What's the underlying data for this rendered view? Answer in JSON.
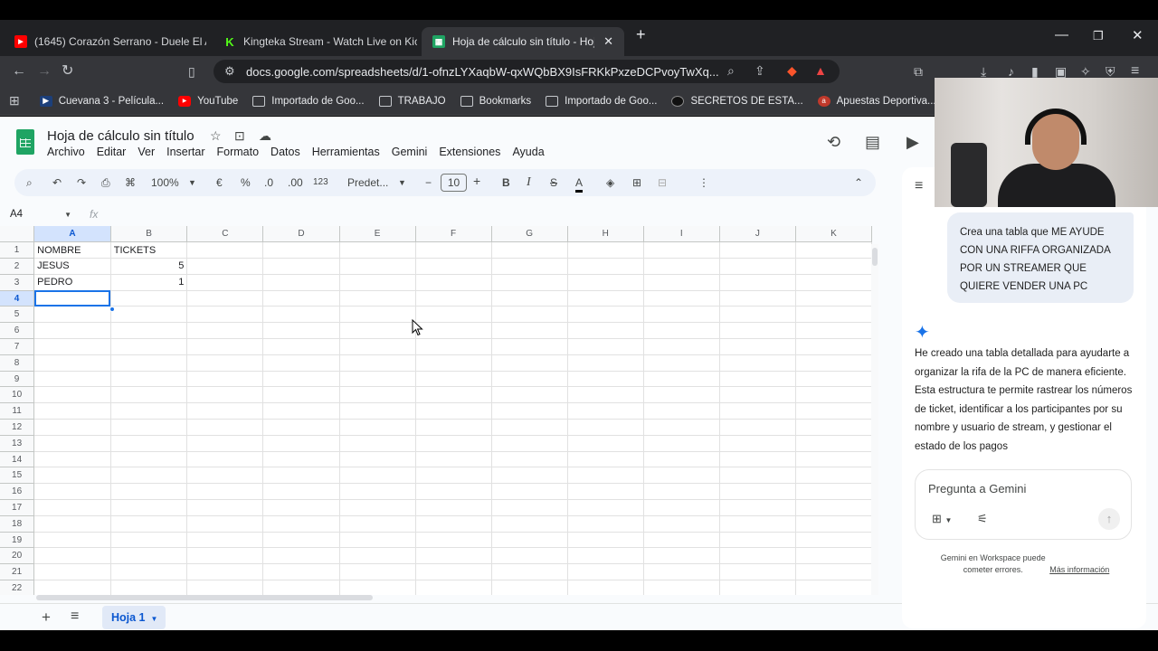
{
  "browser": {
    "tabs": [
      {
        "title": "(1645) Corazón Serrano - Duele El A",
        "icon": "youtube-icon",
        "color": "#ff0000"
      },
      {
        "title": "Kingteka Stream - Watch Live on Kick",
        "icon": "kick-icon",
        "color": "#53fc18"
      },
      {
        "title": "Hoja de cálculo sin título - Hojas",
        "icon": "sheets-icon",
        "color": "#1fa463",
        "active": true
      }
    ],
    "url": "docs.google.com/spreadsheets/d/1-ofnzLYXaqbW-qxWQbBX9IsFRKkPxzeDCPvoyTwXq...",
    "bookmarks": [
      {
        "label": "Cuevana 3 - Película...",
        "icon": "cuevana-icon"
      },
      {
        "label": "YouTube",
        "icon": "youtube-icon"
      },
      {
        "label": "Importado de Goo...",
        "icon": "folder-icon"
      },
      {
        "label": "TRABAJO",
        "icon": "folder-icon"
      },
      {
        "label": "Bookmarks",
        "icon": "bookmarks-icon"
      },
      {
        "label": "Importado de Goo...",
        "icon": "folder-icon"
      },
      {
        "label": "SECRETOS DE ESTA...",
        "icon": "site-icon"
      },
      {
        "label": "Apuestas Deportiva...",
        "icon": "site-icon"
      }
    ]
  },
  "sheets": {
    "title": "Hoja de cálculo sin título",
    "menu": [
      "Archivo",
      "Editar",
      "Ver",
      "Insertar",
      "Formato",
      "Datos",
      "Herramientas",
      "Gemini",
      "Extensiones",
      "Ayuda"
    ],
    "toolbar": {
      "zoom": "100%",
      "currency": "€",
      "percent": "%",
      "dec_decrease": ".0",
      "dec_increase": ".00",
      "number_format": "123",
      "font": "Predet...",
      "font_size": "10",
      "bold": "B",
      "italic": "I",
      "strike": "S",
      "text_color": "A"
    },
    "name_box": "A4",
    "fx": "fx",
    "columns": [
      "A",
      "B",
      "C",
      "D",
      "E",
      "F",
      "G",
      "H",
      "I",
      "J",
      "K"
    ],
    "rows": [
      "1",
      "2",
      "3",
      "4",
      "5",
      "6",
      "7",
      "8",
      "9",
      "10",
      "11",
      "12",
      "13",
      "14",
      "15",
      "16",
      "17",
      "18",
      "19",
      "20",
      "21",
      "22"
    ],
    "cells": {
      "A1": "NOMBRE",
      "B1": "TICKETS",
      "A2": "JESUS",
      "B2": "5",
      "A3": "PEDRO",
      "B3": "1"
    },
    "active_cell": "A4",
    "sheet_tab": "Hoja 1"
  },
  "gemini": {
    "user_message": "Crea una tabla que ME AYUDE CON UNA RIFFA ORGANIZADA POR UN STREAMER QUE QUIERE VENDER UNA PC",
    "response": "He creado una tabla detallada para ayudarte a organizar la rifa de la PC de manera eficiente. Esta estructura te permite rastrear los números de ticket, identificar a los participantes por su nombre y usuario de stream, y gestionar el estado de los pagos",
    "input_placeholder": "Pregunta a Gemini",
    "footer": "Gemini en Workspace puede cometer errores.",
    "footer_link": "Más información"
  }
}
